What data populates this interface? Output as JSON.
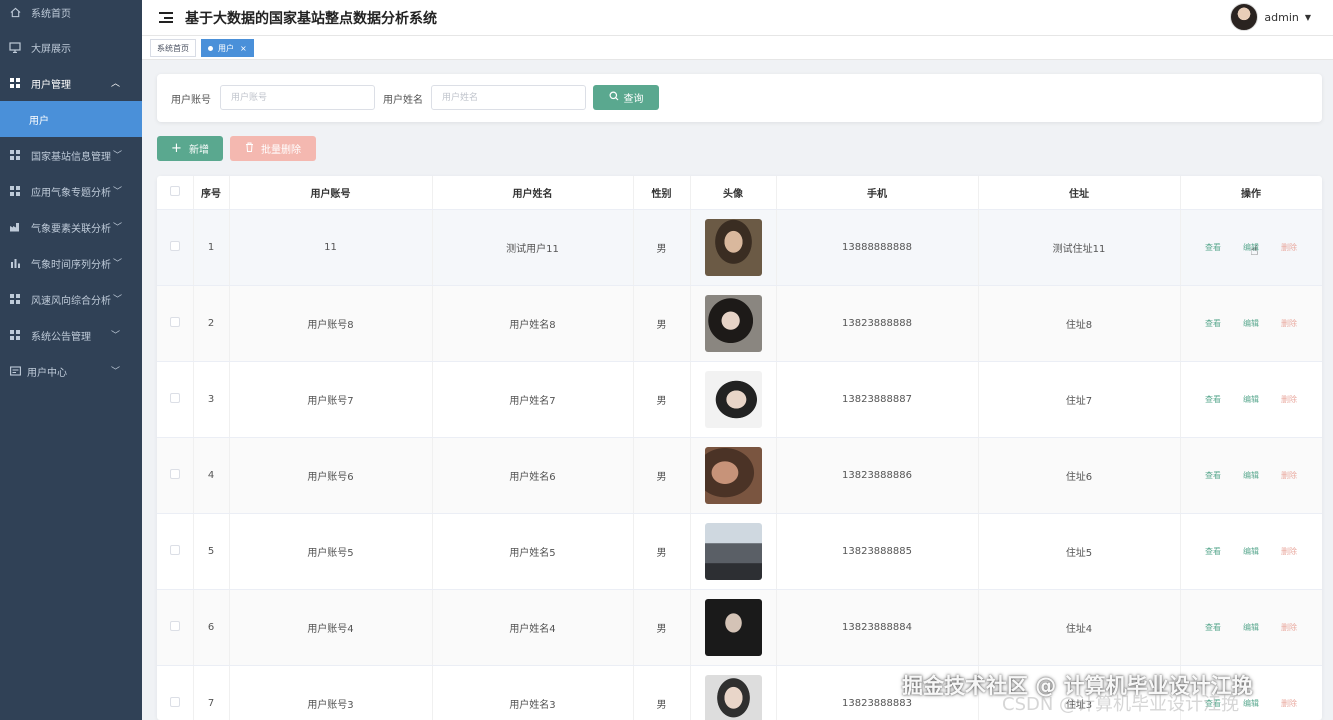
{
  "app": {
    "title": "基于大数据的国家基站整点数据分析系统"
  },
  "user": {
    "name": "admin"
  },
  "sidebar": {
    "items": [
      {
        "label": "系统首页",
        "icon": "home-icon"
      },
      {
        "label": "大屏展示",
        "icon": "monitor-icon"
      },
      {
        "label": "用户管理",
        "icon": "grid-icon",
        "open": true
      },
      {
        "label": "用户",
        "sub": true,
        "active": true
      },
      {
        "label": "国家基站信息管理",
        "icon": "grid-icon"
      },
      {
        "label": "应用气象专题分析",
        "icon": "grid-icon"
      },
      {
        "label": "气象要素关联分析",
        "icon": "factory-icon"
      },
      {
        "label": "气象时间序列分析",
        "icon": "bar-chart-icon"
      },
      {
        "label": "风速风向综合分析",
        "icon": "grid-icon"
      },
      {
        "label": "系统公告管理",
        "icon": "grid-icon"
      },
      {
        "label": "用户中心",
        "icon": "card-icon"
      }
    ]
  },
  "tabs": [
    {
      "label": "系统首页"
    },
    {
      "label": "用户",
      "close": "×"
    }
  ],
  "search": {
    "account_label": "用户账号",
    "account_placeholder": "用户账号",
    "name_label": "用户姓名",
    "name_placeholder": "用户姓名",
    "query_label": "查询"
  },
  "actions": {
    "add_label": "新增",
    "batch_delete_label": "批量删除"
  },
  "table": {
    "headers": [
      "序号",
      "用户账号",
      "用户姓名",
      "性别",
      "头像",
      "手机",
      "住址",
      "操作"
    ],
    "ops": {
      "view": "查看",
      "edit": "编辑",
      "delete": "删除"
    },
    "rows": [
      {
        "no": "1",
        "account": "11",
        "name": "测试用户11",
        "gender": "男",
        "phone": "13888888888",
        "address": "测试住址11"
      },
      {
        "no": "2",
        "account": "用户账号8",
        "name": "用户姓名8",
        "gender": "男",
        "phone": "13823888888",
        "address": "住址8"
      },
      {
        "no": "3",
        "account": "用户账号7",
        "name": "用户姓名7",
        "gender": "男",
        "phone": "13823888887",
        "address": "住址7"
      },
      {
        "no": "4",
        "account": "用户账号6",
        "name": "用户姓名6",
        "gender": "男",
        "phone": "13823888886",
        "address": "住址6"
      },
      {
        "no": "5",
        "account": "用户账号5",
        "name": "用户姓名5",
        "gender": "男",
        "phone": "13823888885",
        "address": "住址5"
      },
      {
        "no": "6",
        "account": "用户账号4",
        "name": "用户姓名4",
        "gender": "男",
        "phone": "13823888884",
        "address": "住址4"
      },
      {
        "no": "7",
        "account": "用户账号3",
        "name": "用户姓名3",
        "gender": "男",
        "phone": "13823888883",
        "address": "住址3"
      }
    ]
  },
  "watermark": {
    "main": "掘金技术社区 @ 计算机毕业设计江挽",
    "sub": "CSDN @计算机毕业设计江挽"
  },
  "colors": {
    "sidebar_bg": "#304156",
    "accent_blue": "#4a90d9",
    "primary_green": "#5aa88f",
    "danger_light": "#f4b8b0"
  }
}
